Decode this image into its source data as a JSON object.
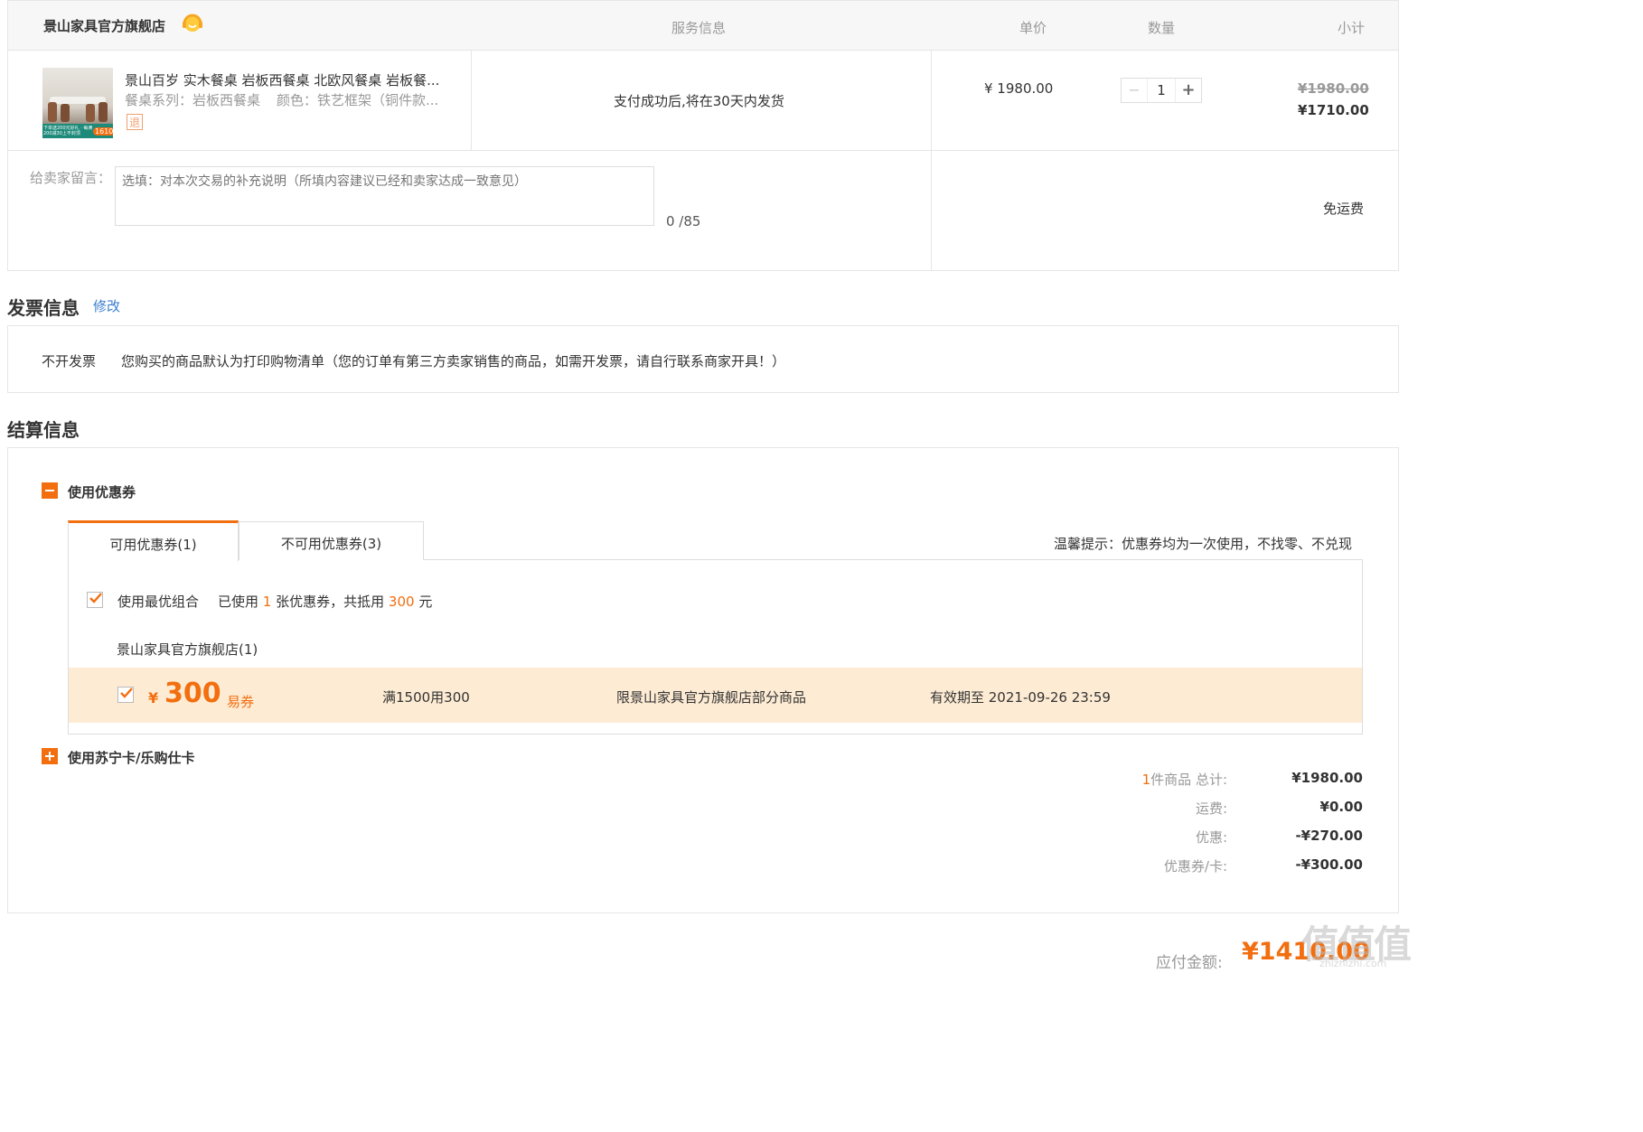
{
  "store": {
    "name": "景山家具官方旗舰店",
    "icon": "customer-service-icon"
  },
  "table_headers": {
    "service": "服务信息",
    "unit_price": "单价",
    "quantity": "数量",
    "subtotal": "小计"
  },
  "product": {
    "title": "景山百岁 实木餐桌 岩板西餐桌 北欧风餐桌 岩板餐...",
    "spec_series": "餐桌系列：岩板西餐桌",
    "spec_color": "颜色：铁艺框架（铜件款...",
    "return_badge": "退",
    "image_caption": "下单送200元好礼 · 每满200减30上不封顶",
    "image_badge": "1610",
    "service_info": "支付成功后,将在30天内发货",
    "unit_price": "¥ 1980.00",
    "quantity": "1",
    "qty_minus": "−",
    "qty_plus": "+",
    "original_subtotal": "¥1980.00",
    "subtotal": "¥1710.00"
  },
  "message": {
    "label": "给卖家留言：",
    "placeholder": "选填：对本次交易的补充说明（所填内容建议已经和卖家达成一致意见）",
    "value": "",
    "counter": "0 /85",
    "shipping": "免运费"
  },
  "invoice": {
    "title": "发票信息",
    "edit_link": "修改",
    "type": "不开发票",
    "note": "您购买的商品默认为打印购物清单（您的订单有第三方卖家销售的商品，如需开发票，请自行联系商家开具！）"
  },
  "settlement": {
    "title": "结算信息",
    "coupon_section": {
      "title": "使用优惠券",
      "tabs": [
        {
          "label": "可用优惠券(1)",
          "active": true
        },
        {
          "label": "不可用优惠券(3)",
          "active": false
        }
      ],
      "tip": "温馨提示：优惠券均为一次使用，不找零、不兑现",
      "best_combo": {
        "label": "使用最优组合",
        "used_prefix": "已使用",
        "used_count": "1",
        "used_mid": "张优惠券，共抵用",
        "used_amount": "300",
        "used_suffix": "元",
        "checked": true
      },
      "store_group": "景山家具官方旗舰店(1)",
      "coupon": {
        "currency": "¥",
        "amount": "300",
        "type": "易券",
        "condition": "满1500用300",
        "scope": "限景山家具官方旗舰店部分商品",
        "expiry": "有效期至 2021-09-26 23:59",
        "checked": true
      }
    },
    "card_section": {
      "title": "使用苏宁卡/乐购仕卡"
    },
    "summary": {
      "items_count": "1",
      "items_label": "件商品 总计:",
      "items_total": "¥1980.00",
      "shipping_label": "运费:",
      "shipping_value": "¥0.00",
      "discount_label": "优惠:",
      "discount_value": "-¥270.00",
      "coupon_label": "优惠券/卡:",
      "coupon_value": "-¥300.00"
    },
    "payable_label": "应付金额:",
    "payable_value": "¥1410.00"
  },
  "watermark": {
    "logo": "值",
    "site": "zhizhizhi.com"
  },
  "colors": {
    "accent": "#f26e0f",
    "coupon_row_bg": "#fdebd3",
    "link": "#3a7ed0",
    "border": "#e6e6e6"
  }
}
